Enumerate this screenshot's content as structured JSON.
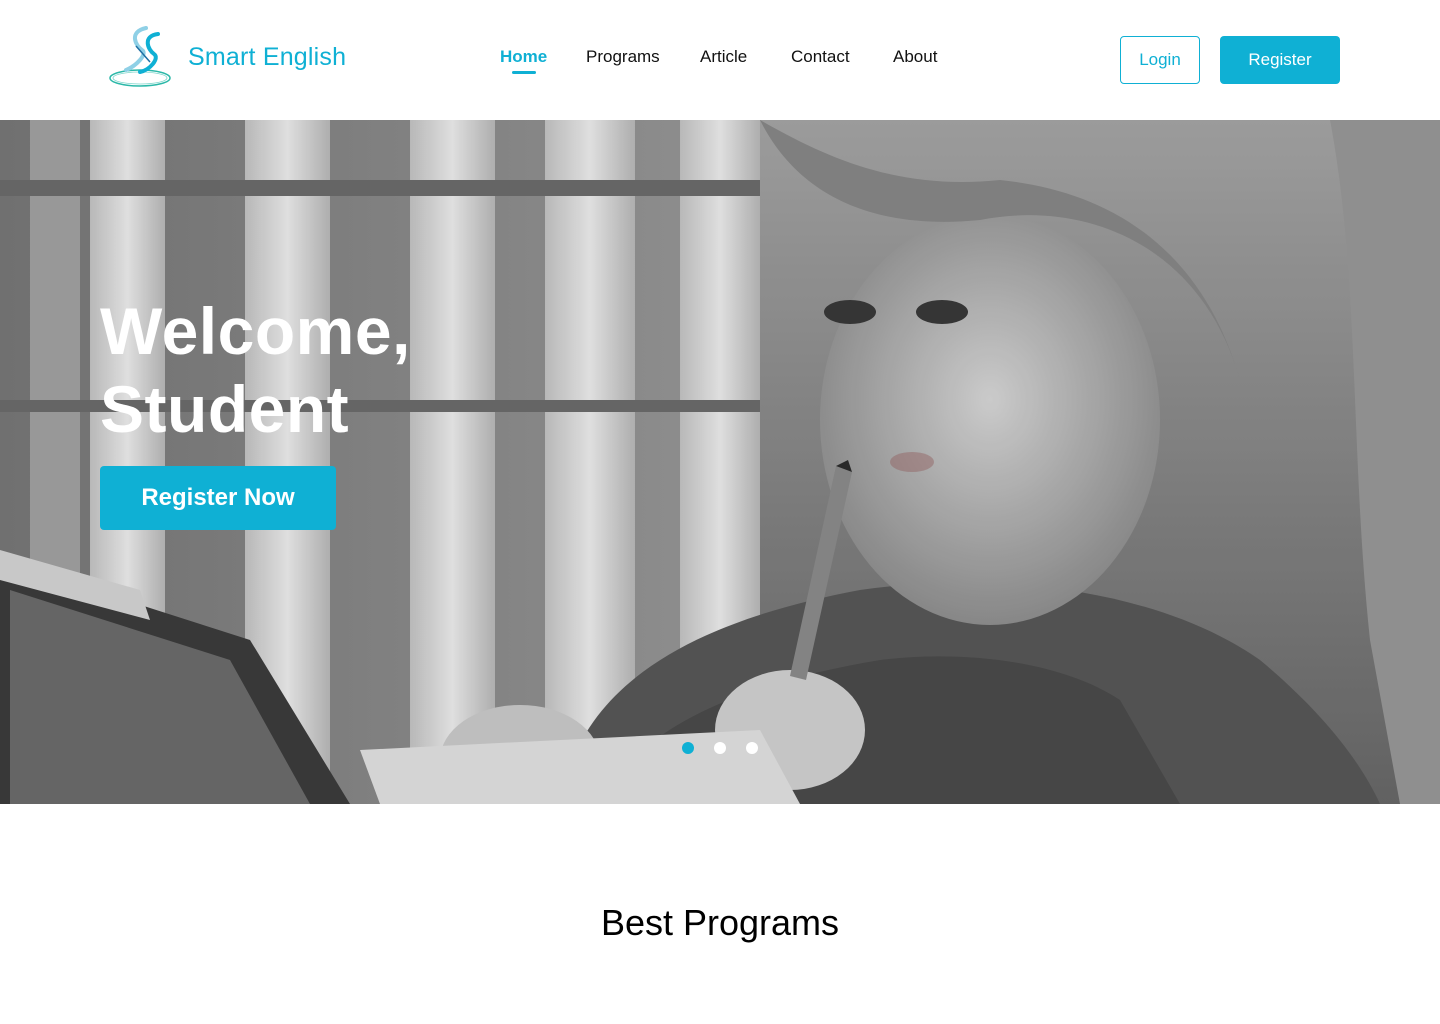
{
  "brand": {
    "name": "Smart English",
    "logo_icon": "smart-english-logo"
  },
  "nav": {
    "items": [
      {
        "label": "Home",
        "active": true
      },
      {
        "label": "Programs",
        "active": false
      },
      {
        "label": "Article",
        "active": false
      },
      {
        "label": "Contact",
        "active": false
      },
      {
        "label": "About",
        "active": false
      }
    ]
  },
  "auth": {
    "login_label": "Login",
    "register_label": "Register"
  },
  "hero": {
    "title_line1": "Welcome,",
    "title_line2": "Student",
    "cta_label": "Register Now",
    "image_subject": "child-writing-with-pencil-grayscale-photo",
    "carousel": {
      "count": 3,
      "active_index": 0
    }
  },
  "section": {
    "title": "Best Programs"
  },
  "colors": {
    "accent": "#0fb0d4",
    "text": "#111111",
    "background": "#ffffff"
  }
}
